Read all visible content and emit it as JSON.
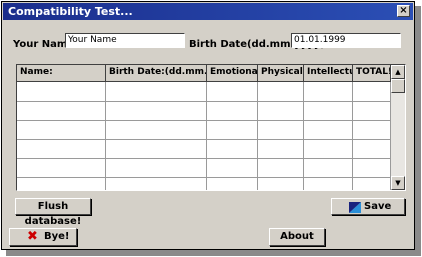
{
  "window": {
    "title": "Compatibility Test..."
  },
  "form": {
    "name_label": "Your Name:",
    "name_value": "Your Name",
    "birth_label": "Birth Date(dd.mm.yyyy):",
    "birth_value": "01.01.1999"
  },
  "grid": {
    "columns": [
      "Name:",
      "Birth Date:(dd.mm.yyyy",
      "Emotional",
      "Physical",
      "Intellectua",
      "TOTAL!"
    ]
  },
  "buttons": {
    "flush": "Flush database!",
    "save": "Save",
    "bye": "Bye!",
    "about": "About"
  },
  "icons": {
    "close": "close-icon",
    "save": "save-icon",
    "bye": "red-x-icon",
    "scroll_up": "arrow-up-icon",
    "scroll_down": "arrow-down-icon"
  },
  "colors": {
    "titlebar": "#1a2d8c",
    "face": "#d4d0c8",
    "bye_x": "#cc0000"
  }
}
